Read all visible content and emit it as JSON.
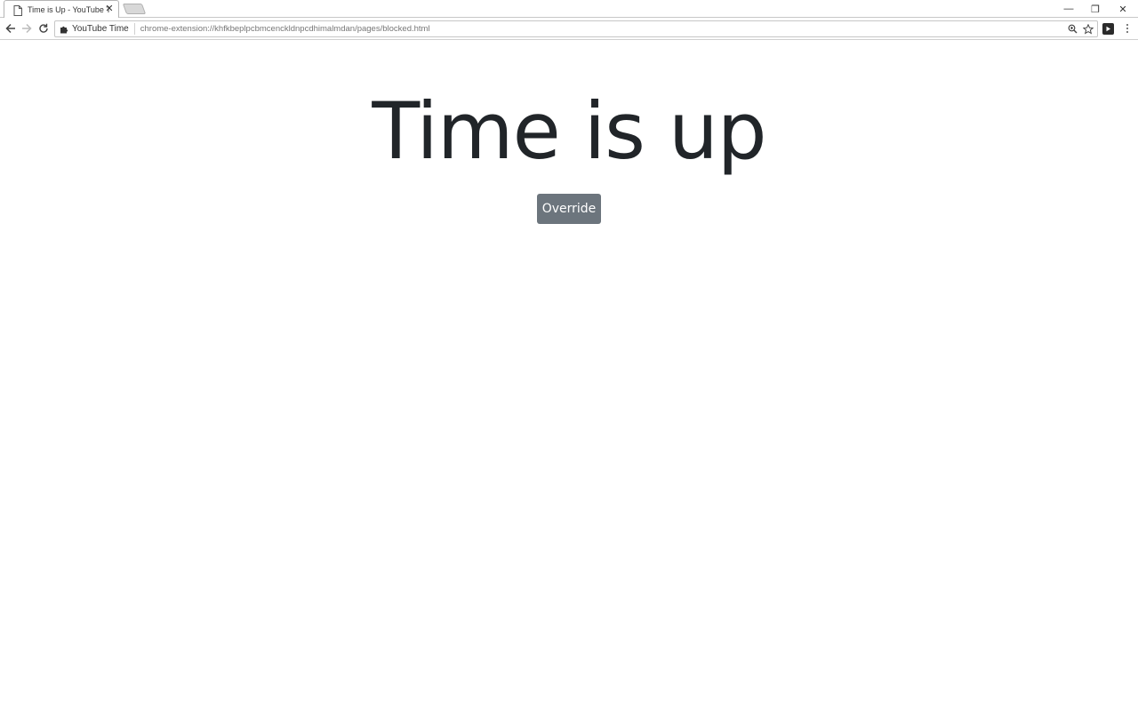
{
  "browser": {
    "tab": {
      "title": "Time is Up - YouTube Ti",
      "icon": "page-icon",
      "close_glyph": "✕"
    },
    "window_controls": {
      "minimize_glyph": "—",
      "restore_glyph": "❐",
      "close_glyph": "✕"
    },
    "toolbar": {
      "back_icon": "back-arrow-icon",
      "forward_icon": "forward-arrow-icon",
      "reload_icon": "reload-icon"
    },
    "omnibox": {
      "chip_label": "YouTube Time",
      "chip_icon": "puzzle-icon",
      "url": "chrome-extension://khfkbeplpcbmcenckldnpcdhimalmdan/pages/blocked.html",
      "zoom_icon": "zoom-icon",
      "star_icon": "star-icon"
    }
  },
  "page": {
    "heading": "Time is up",
    "override_label": "Override",
    "button_color": "#6c757d",
    "text_color": "#212529"
  }
}
